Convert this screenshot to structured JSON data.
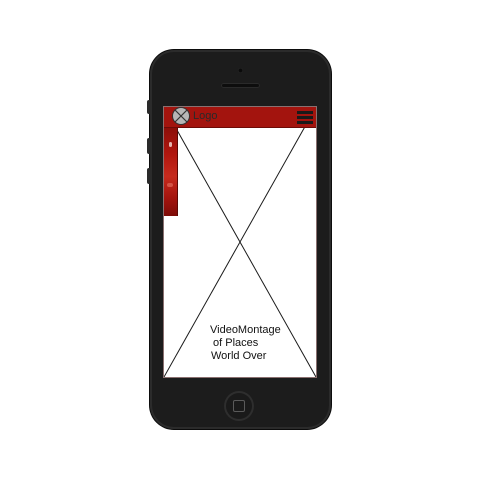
{
  "header": {
    "logo_label": "Logo",
    "menu_icon": "hamburger-menu-icon",
    "bar_color": "#a3140e"
  },
  "hero": {
    "placeholder_icon": "image-placeholder-icon",
    "text_line1": "VideoMontage",
    "text_line2": "of Places",
    "text_line3": "World Over"
  },
  "device": {
    "type": "smartphone-mockup",
    "body_color": "#1c1c1c"
  }
}
